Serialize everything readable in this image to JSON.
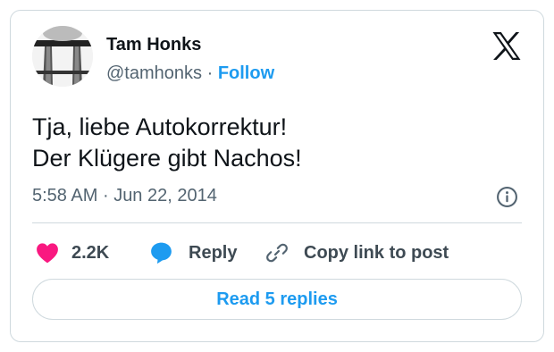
{
  "author": {
    "name": "Tam Honks",
    "handle": "@tamhonks",
    "separator": "·",
    "follow_label": "Follow"
  },
  "tweet": {
    "lines": [
      "Tja, liebe Autokorrektur!",
      "Der Klügere gibt Nachos!"
    ],
    "time": "5:58 AM",
    "date_separator": "·",
    "date": "Jun 22, 2014"
  },
  "actions": {
    "likes": "2.2K",
    "reply_label": "Reply",
    "copy_label": "Copy link to post"
  },
  "read_replies_label": "Read 5 replies",
  "icons": {
    "logo": "x-logo-icon",
    "info": "info-icon",
    "like": "heart-icon",
    "reply": "speech-bubble-icon",
    "copy": "link-icon"
  },
  "colors": {
    "accent": "#1d9bf0",
    "like": "#f91880",
    "text": "#0f1419",
    "secondary": "#536471",
    "border": "#cfd9de"
  }
}
